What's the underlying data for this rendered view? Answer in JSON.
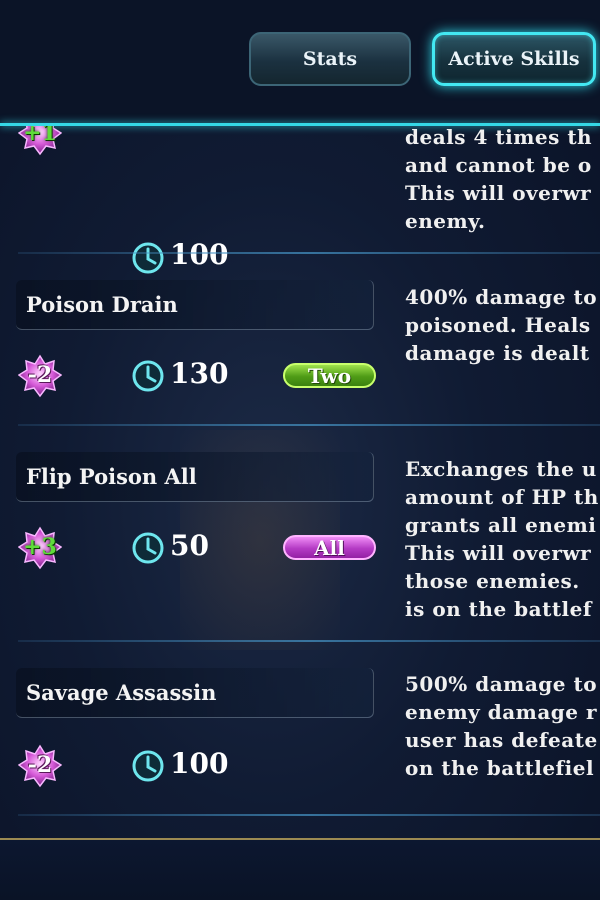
{
  "tabs": {
    "stats_label": "Stats",
    "active_skills_label": "Active Skills"
  },
  "skills": [
    {
      "name": "",
      "cost": "+1",
      "cooldown": "100",
      "target": "",
      "description": [
        "deals 4 times th",
        "and cannot be o",
        "This will overwr",
        "enemy."
      ]
    },
    {
      "name": "Poison Drain",
      "cost": "-2",
      "cooldown": "130",
      "target": "Two",
      "description": [
        "400% damage to",
        "poisoned. Heals",
        "damage is dealt"
      ]
    },
    {
      "name": "Flip Poison All",
      "cost": "+3",
      "cooldown": "50",
      "target": "All",
      "description": [
        "Exchanges the u",
        "amount of HP th",
        "grants all enemi",
        "This will overwr",
        "those enemies.",
        "is on the battlef"
      ]
    },
    {
      "name": "Savage Assassin",
      "cost": "-2",
      "cooldown": "100",
      "target": "",
      "description": [
        "500% damage to",
        "enemy damage r",
        "user has defeate",
        "on the battlefiel"
      ]
    }
  ],
  "colors": {
    "accent_cyan": "#43e8f2",
    "target_two": "#6fc02a",
    "target_all": "#d060e0",
    "cost_plus": "#5fdc3a"
  }
}
